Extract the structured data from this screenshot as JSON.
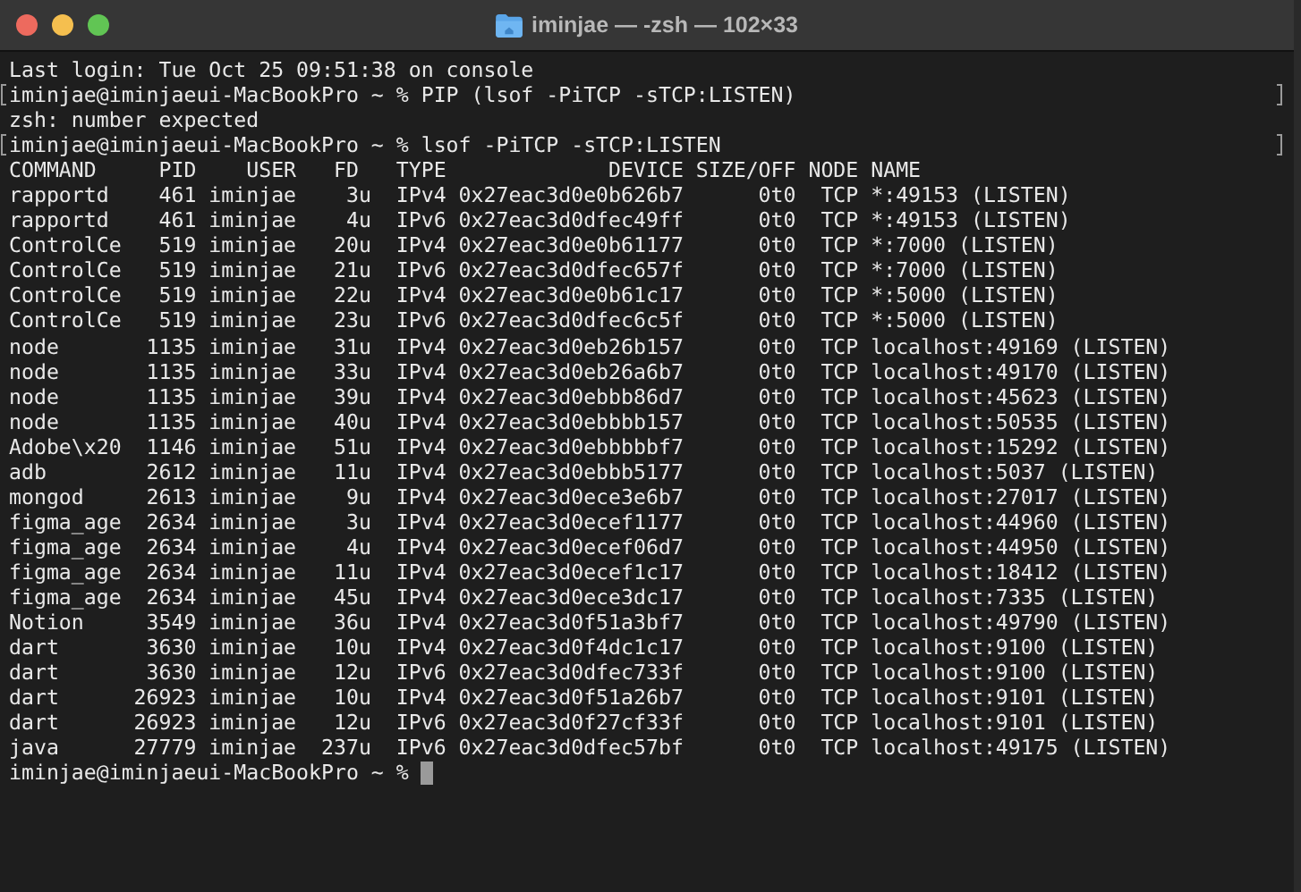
{
  "window": {
    "title": "iminjae — -zsh — 102×33"
  },
  "lines": [
    {
      "text": "Last login: Tue Oct 25 09:51:38 on console",
      "marked": false
    },
    {
      "text": "iminjae@iminjaeui-MacBookPro ~ % PIP (lsof -PiTCP -sTCP:LISTEN)",
      "marked": true
    },
    {
      "text": "zsh: number expected",
      "marked": false
    },
    {
      "text": "iminjae@iminjaeui-MacBookPro ~ % lsof -PiTCP -sTCP:LISTEN",
      "marked": true
    },
    {
      "text": "COMMAND     PID    USER   FD   TYPE             DEVICE SIZE/OFF NODE NAME",
      "marked": false
    },
    {
      "text": "rapportd    461 iminjae    3u  IPv4 0x27eac3d0e0b626b7      0t0  TCP *:49153 (LISTEN)",
      "marked": false
    },
    {
      "text": "rapportd    461 iminjae    4u  IPv6 0x27eac3d0dfec49ff      0t0  TCP *:49153 (LISTEN)",
      "marked": false
    },
    {
      "text": "ControlCe   519 iminjae   20u  IPv4 0x27eac3d0e0b61177      0t0  TCP *:7000 (LISTEN)",
      "marked": false
    },
    {
      "text": "ControlCe   519 iminjae   21u  IPv6 0x27eac3d0dfec657f      0t0  TCP *:7000 (LISTEN)",
      "marked": false
    },
    {
      "text": "ControlCe   519 iminjae   22u  IPv4 0x27eac3d0e0b61c17      0t0  TCP *:5000 (LISTEN)",
      "marked": false
    },
    {
      "text": "ControlCe   519 iminjae   23u  IPv6 0x27eac3d0dfec6c5f      0t0  TCP *:5000 (LISTEN)",
      "marked": false
    },
    {
      "text": "node       1135 iminjae   31u  IPv4 0x27eac3d0eb26b157      0t0  TCP localhost:49169 (LISTEN)",
      "marked": false
    },
    {
      "text": "node       1135 iminjae   33u  IPv4 0x27eac3d0eb26a6b7      0t0  TCP localhost:49170 (LISTEN)",
      "marked": false
    },
    {
      "text": "node       1135 iminjae   39u  IPv4 0x27eac3d0ebbb86d7      0t0  TCP localhost:45623 (LISTEN)",
      "marked": false
    },
    {
      "text": "node       1135 iminjae   40u  IPv4 0x27eac3d0ebbbb157      0t0  TCP localhost:50535 (LISTEN)",
      "marked": false
    },
    {
      "text": "Adobe\\x20  1146 iminjae   51u  IPv4 0x27eac3d0ebbbbbf7      0t0  TCP localhost:15292 (LISTEN)",
      "marked": false
    },
    {
      "text": "adb        2612 iminjae   11u  IPv4 0x27eac3d0ebbb5177      0t0  TCP localhost:5037 (LISTEN)",
      "marked": false
    },
    {
      "text": "mongod     2613 iminjae    9u  IPv4 0x27eac3d0ece3e6b7      0t0  TCP localhost:27017 (LISTEN)",
      "marked": false
    },
    {
      "text": "figma_age  2634 iminjae    3u  IPv4 0x27eac3d0ecef1177      0t0  TCP localhost:44960 (LISTEN)",
      "marked": false
    },
    {
      "text": "figma_age  2634 iminjae    4u  IPv4 0x27eac3d0ecef06d7      0t0  TCP localhost:44950 (LISTEN)",
      "marked": false
    },
    {
      "text": "figma_age  2634 iminjae   11u  IPv4 0x27eac3d0ecef1c17      0t0  TCP localhost:18412 (LISTEN)",
      "marked": false
    },
    {
      "text": "figma_age  2634 iminjae   45u  IPv4 0x27eac3d0ece3dc17      0t0  TCP localhost:7335 (LISTEN)",
      "marked": false
    },
    {
      "text": "Notion     3549 iminjae   36u  IPv4 0x27eac3d0f51a3bf7      0t0  TCP localhost:49790 (LISTEN)",
      "marked": false
    },
    {
      "text": "dart       3630 iminjae   10u  IPv4 0x27eac3d0f4dc1c17      0t0  TCP localhost:9100 (LISTEN)",
      "marked": false
    },
    {
      "text": "dart       3630 iminjae   12u  IPv6 0x27eac3d0dfec733f      0t0  TCP localhost:9100 (LISTEN)",
      "marked": false
    },
    {
      "text": "dart      26923 iminjae   10u  IPv4 0x27eac3d0f51a26b7      0t0  TCP localhost:9101 (LISTEN)",
      "marked": false
    },
    {
      "text": "dart      26923 iminjae   12u  IPv6 0x27eac3d0f27cf33f      0t0  TCP localhost:9101 (LISTEN)",
      "marked": false
    },
    {
      "text": "java      27779 iminjae  237u  IPv6 0x27eac3d0dfec57bf      0t0  TCP localhost:49175 (LISTEN)",
      "marked": false
    }
  ],
  "prompt": {
    "text": "iminjae@iminjaeui-MacBookPro ~ %",
    "cursor": true
  }
}
